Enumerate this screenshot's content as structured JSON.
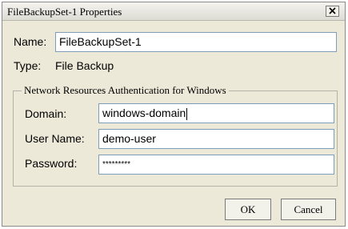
{
  "window": {
    "title": "FileBackupSet-1 Properties"
  },
  "form": {
    "name_label": "Name:",
    "name_value": "FileBackupSet-1",
    "type_label": "Type:",
    "type_value": "File Backup"
  },
  "auth_group": {
    "title": "Network Resources Authentication for Windows",
    "domain_label": "Domain:",
    "domain_value": "windows-domain",
    "username_label": "User Name:",
    "username_value": "demo-user",
    "password_label": "Password:",
    "password_value": "*********"
  },
  "buttons": {
    "ok": "OK",
    "cancel": "Cancel"
  },
  "icons": {
    "close": "close-icon"
  }
}
